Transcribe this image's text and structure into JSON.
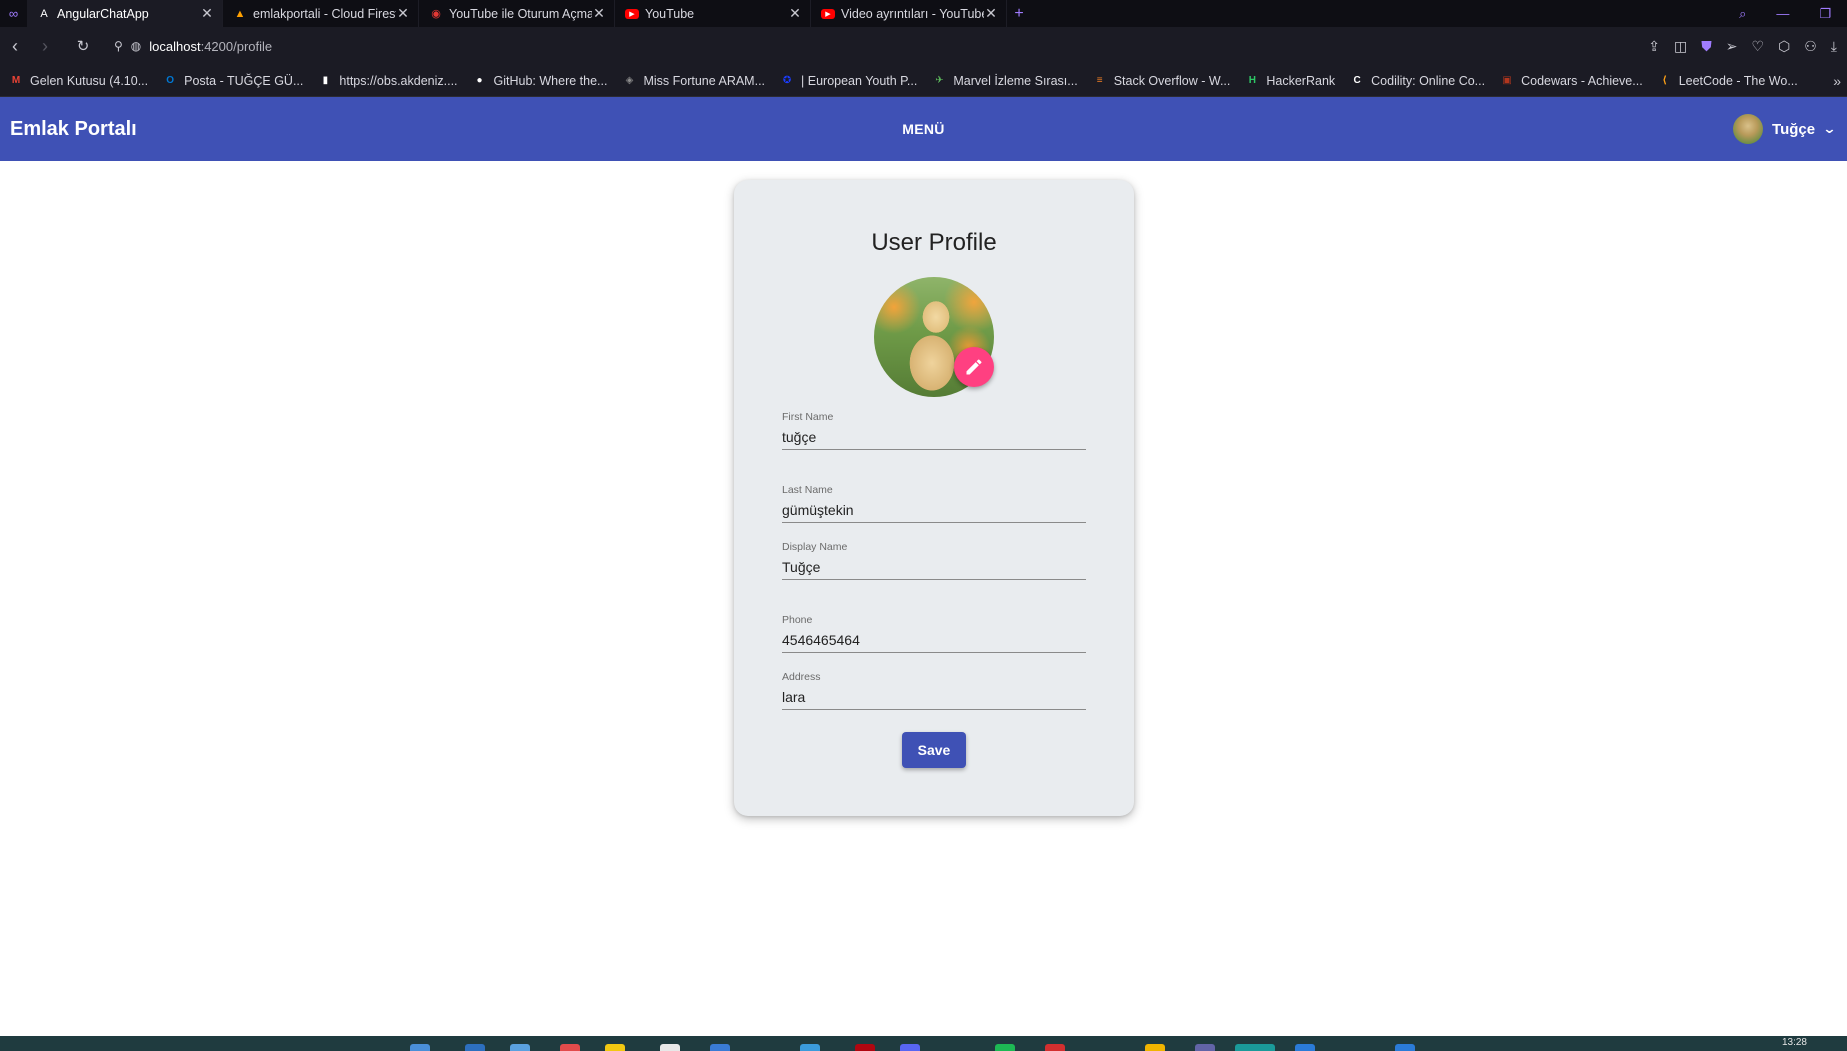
{
  "browser": {
    "tabs": [
      {
        "title": "AngularChatApp",
        "active": true,
        "icon": "angular-icon",
        "icon_color": "#ffffff"
      },
      {
        "title": "emlakportali - Cloud Firest",
        "active": false,
        "icon": "firebase-icon",
        "icon_color": "#ffa000"
      },
      {
        "title": "YouTube ile Oturum Açma",
        "active": false,
        "icon": "google-icon",
        "icon_color": "#e53935"
      },
      {
        "title": "YouTube",
        "active": false,
        "icon": "youtube-icon",
        "icon_color": "#ff0000"
      },
      {
        "title": "Video ayrıntıları - YouTube",
        "active": false,
        "icon": "youtube-icon",
        "icon_color": "#ff0000"
      }
    ],
    "new_tab": "+",
    "address": {
      "host": "localhost",
      "path": ":4200/profile"
    },
    "bookmarks": [
      {
        "label": "Gelen Kutusu (4.10...",
        "icon": "gmail-icon",
        "icon_color": "#ea4335"
      },
      {
        "label": "Posta - TUĞÇE GÜ...",
        "icon": "outlook-icon",
        "icon_color": "#0078d4"
      },
      {
        "label": "https://obs.akdeniz....",
        "icon": "document-icon",
        "icon_color": "#ffffff"
      },
      {
        "label": "GitHub: Where the...",
        "icon": "github-icon",
        "icon_color": "#ffffff"
      },
      {
        "label": "Miss Fortune ARAM...",
        "icon": "game-icon",
        "icon_color": "#8e8e8e"
      },
      {
        "label": "| European Youth P...",
        "icon": "eu-icon",
        "icon_color": "#1a3cff"
      },
      {
        "label": "Marvel İzleme Sırası...",
        "icon": "marvel-icon",
        "icon_color": "#5cb85c"
      },
      {
        "label": "Stack Overflow - W...",
        "icon": "stackoverflow-icon",
        "icon_color": "#f48024"
      },
      {
        "label": "HackerRank",
        "icon": "hackerrank-icon",
        "icon_color": "#2ec866"
      },
      {
        "label": "Codility: Online Co...",
        "icon": "codility-icon",
        "icon_color": "#ffffff"
      },
      {
        "label": "Codewars - Achieve...",
        "icon": "codewars-icon",
        "icon_color": "#b1361e"
      },
      {
        "label": "LeetCode - The Wo...",
        "icon": "leetcode-icon",
        "icon_color": "#ffa116"
      }
    ]
  },
  "app": {
    "brand": "Emlak Portalı",
    "menu_label": "MENÜ",
    "user_name": "Tuğçe",
    "primary_color": "#3f51b5",
    "accent_color": "#ff4081"
  },
  "profile": {
    "title": "User Profile",
    "fields": [
      {
        "label": "First Name",
        "value": "tuğçe"
      },
      {
        "label": "Last Name",
        "value": "gümüştekin"
      },
      {
        "label": "Display Name",
        "value": "Tuğçe"
      },
      {
        "label": "Phone",
        "value": "4546465464"
      },
      {
        "label": "Address",
        "value": "lara"
      }
    ],
    "save_label": "Save"
  },
  "taskbar": {
    "clock": "13:28"
  }
}
